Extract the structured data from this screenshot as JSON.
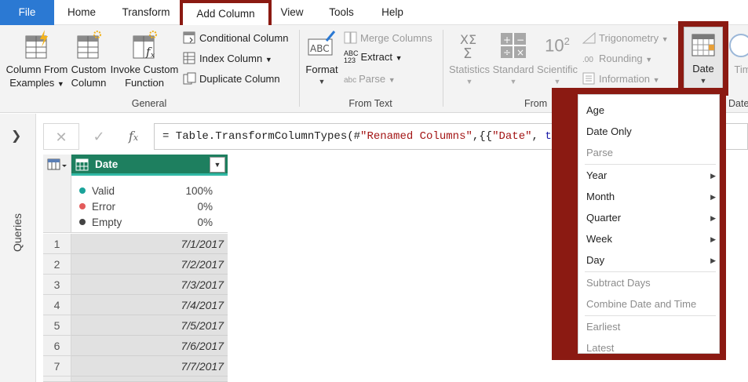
{
  "menubar": {
    "tabs": [
      {
        "label": "File"
      },
      {
        "label": "Home"
      },
      {
        "label": "Transform"
      },
      {
        "label": "Add Column"
      },
      {
        "label": "View"
      },
      {
        "label": "Tools"
      },
      {
        "label": "Help"
      }
    ]
  },
  "ribbon": {
    "general": {
      "column_from_examples": {
        "line1": "Column From",
        "line2": "Examples"
      },
      "custom_column": {
        "line1": "Custom",
        "line2": "Column"
      },
      "invoke_custom_function": {
        "line1": "Invoke Custom",
        "line2": "Function"
      },
      "conditional_column": "Conditional Column",
      "index_column": "Index Column",
      "duplicate_column": "Duplicate Column",
      "group_label": "General"
    },
    "from_text": {
      "format": "Format",
      "merge_columns": "Merge Columns",
      "extract": "Extract",
      "parse": "Parse",
      "abc_icon_text": "ABC",
      "abc_small": "ABC",
      "num_small": "123",
      "abc_lower": "abc",
      "group_label": "From Text"
    },
    "from_number": {
      "statistics": "Statistics",
      "standard": "Standard",
      "scientific": "Scientific",
      "scientific_icon": "10",
      "scientific_sup": "2",
      "trigonometry": "Trigonometry",
      "rounding": "Rounding",
      "information": "Information",
      "rounding_icon": ".00",
      "group_label_partial": "From"
    },
    "date": {
      "label": "Date"
    },
    "time": {
      "label_partial": "Tim"
    },
    "group_label_date_partial": "Date"
  },
  "leftpane": {
    "label": "Queries"
  },
  "formula": {
    "prefix": "= Table.TransformColumnTypes(#",
    "str1": "\"Renamed Columns\"",
    "mid": ",{{",
    "str2": "\"Date\"",
    "mid2": ", ",
    "kw": "ty"
  },
  "grid": {
    "column_header": "Date",
    "quality": [
      {
        "label": "Valid",
        "pct": "100%",
        "color": "#1aa39a"
      },
      {
        "label": "Error",
        "pct": "0%",
        "color": "#e35b5b"
      },
      {
        "label": "Empty",
        "pct": "0%",
        "color": "#444444"
      }
    ],
    "rows": [
      {
        "num": "1",
        "value": "7/1/2017"
      },
      {
        "num": "2",
        "value": "7/2/2017"
      },
      {
        "num": "3",
        "value": "7/3/2017"
      },
      {
        "num": "4",
        "value": "7/4/2017"
      },
      {
        "num": "5",
        "value": "7/5/2017"
      },
      {
        "num": "6",
        "value": "7/6/2017"
      },
      {
        "num": "7",
        "value": "7/7/2017"
      }
    ]
  },
  "dropdown": {
    "items": [
      {
        "label": "Age"
      },
      {
        "label": "Date Only"
      },
      {
        "label": "Parse"
      },
      {
        "label": "Year"
      },
      {
        "label": "Month"
      },
      {
        "label": "Quarter"
      },
      {
        "label": "Week"
      },
      {
        "label": "Day"
      },
      {
        "label": "Subtract Days"
      },
      {
        "label": "Combine Date and Time"
      },
      {
        "label": "Earliest"
      },
      {
        "label": "Latest"
      }
    ]
  },
  "colors": {
    "highlight": "#8b1a12",
    "file_tab": "#2b79d3",
    "header_green": "#217346"
  }
}
